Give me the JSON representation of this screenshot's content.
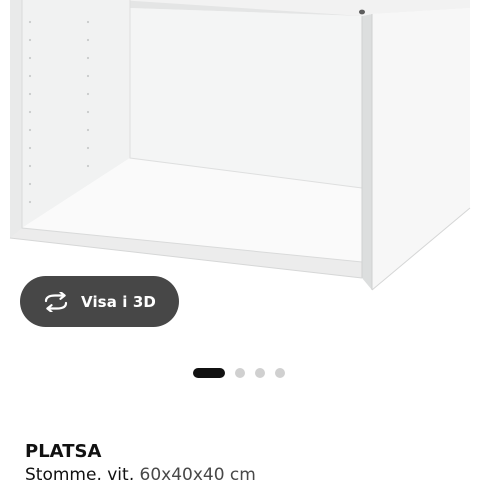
{
  "product_image": {
    "alt": "",
    "icon": "white-open-frame-cabinet"
  },
  "view_3d_button": {
    "label": "Visa i 3D",
    "icon": "rotate-arrows-icon",
    "bg_color": "#474747"
  },
  "carousel": {
    "total": 4,
    "active_index": 0
  },
  "product": {
    "name": "PLATSA",
    "description": "Stomme, vit,",
    "measurements": "60x40x40 cm"
  }
}
